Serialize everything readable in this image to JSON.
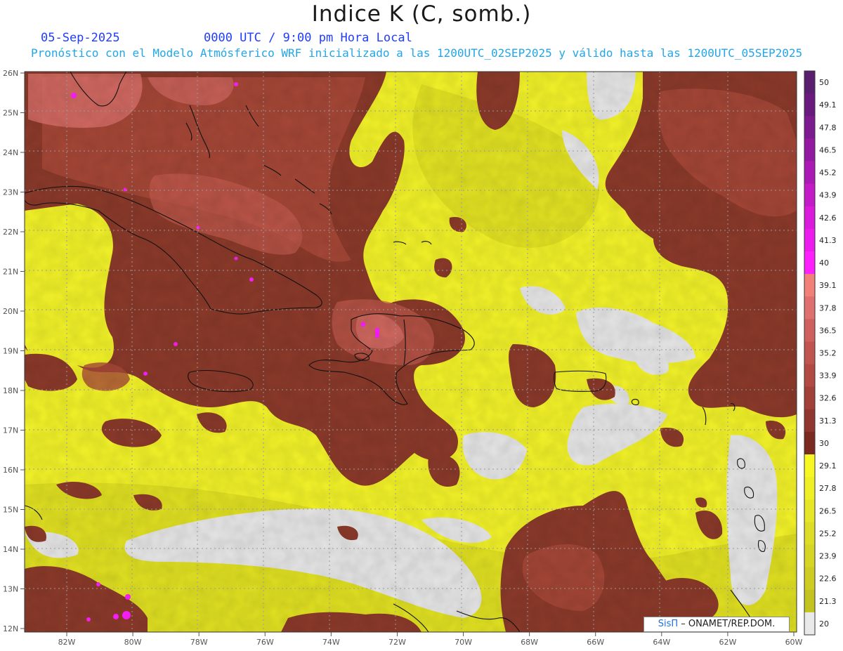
{
  "header": {
    "title": "Indice K (C, somb.)",
    "date": "05-Sep-2025",
    "time": "0000 UTC / 9:00 pm Hora Local",
    "subtitle": "Pronóstico con el Modelo Atmósferico WRF inicializado a las 1200UTC_02SEP2025 y válido hasta las  1200UTC_05SEP2025"
  },
  "map": {
    "lat_labels": [
      "26N",
      "25N",
      "24N",
      "23N",
      "22N",
      "21N",
      "20N",
      "19N",
      "18N",
      "17N",
      "16N",
      "15N",
      "14N",
      "13N",
      "12N"
    ],
    "lon_labels": [
      "82W",
      "80W",
      "78W",
      "76W",
      "74W",
      "72W",
      "70W",
      "68W",
      "66W",
      "64W",
      "62W",
      "60W"
    ],
    "colors": {
      "background_gray": "#e6e6e6",
      "yellow": "#f2f229",
      "olive": "#d2d21e",
      "dark_red": "#8b3a2a",
      "red": "#a94a3a",
      "salmon": "#d9706a",
      "magenta": "#ff1fff"
    }
  },
  "colorbar": {
    "labels": [
      "50",
      "49.1",
      "47.8",
      "46.5",
      "45.2",
      "43.9",
      "42.6",
      "41.3",
      "40",
      "39.1",
      "37.8",
      "36.5",
      "35.2",
      "33.9",
      "32.6",
      "31.3",
      "30",
      "29.1",
      "27.8",
      "26.5",
      "25.2",
      "23.9",
      "22.6",
      "21.3",
      "20"
    ],
    "colors": [
      "#5a1e6e",
      "#6a1a7e",
      "#7d1a8f",
      "#9419a2",
      "#ab1ab5",
      "#c41bc8",
      "#d91bdc",
      "#ec1bee",
      "#ff1fff",
      "#f08078",
      "#e07070",
      "#d06060",
      "#c05550",
      "#b04a42",
      "#a04038",
      "#903530",
      "#7a2a20",
      "#f7f723",
      "#efef26",
      "#e6e628",
      "#dddd28",
      "#d5d526",
      "#cccc22",
      "#c3c31f",
      "#e9e9e9"
    ]
  },
  "credit": {
    "brand": "SisΠ",
    "text": "– ONAMET/REP.DOM."
  }
}
